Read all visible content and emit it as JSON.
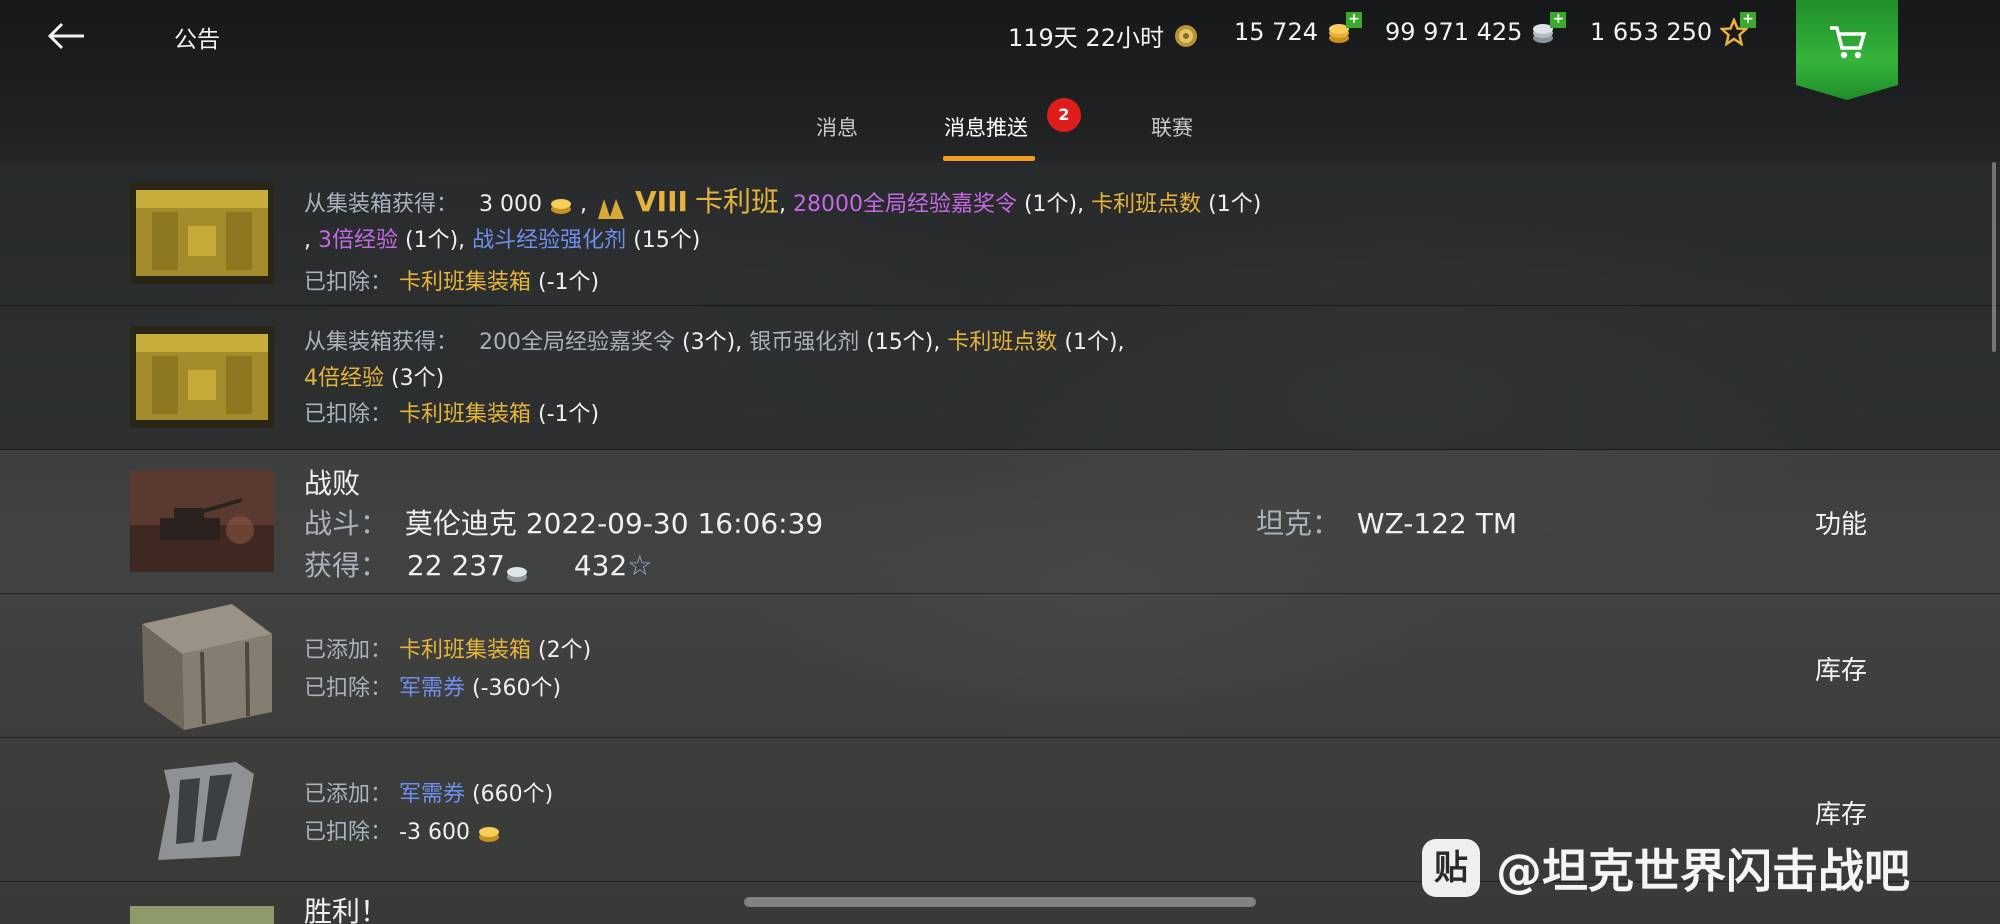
{
  "header": {
    "title": "公告",
    "premium": "119天 22小时",
    "gold": "15 724",
    "silver": "99 971 425",
    "free_xp": "1 653 250"
  },
  "tabs": [
    {
      "label": "消息"
    },
    {
      "label": "消息推送",
      "badge": "2"
    },
    {
      "label": "联赛"
    }
  ],
  "rows": [
    {
      "l1_label": "从集装箱获得：",
      "l1_gold": "3 000",
      "l1_sep": ",",
      "l1_tier": "VIII",
      "l1_tank": "卡利班",
      "l1_c": ",",
      "l1_item1": "28000全局经验嘉奖令",
      "l1_item1_n": "(1个),",
      "l1_item2": "卡利班点数",
      "l1_item2_n": "(1个)",
      "l2_c": ",",
      "l2_item1": "3倍经验",
      "l2_item1_n": "(1个),",
      "l2_item2": "战斗经验强化剂",
      "l2_item2_n": "(15个)",
      "l3_label": "已扣除：",
      "l3_item": "卡利班集装箱",
      "l3_n": "(-1个)"
    },
    {
      "l1_label": "从集装箱获得：",
      "l1_item1": "200全局经验嘉奖令",
      "l1_item1_n": "(3个),",
      "l1_item2": "银币强化剂",
      "l1_item2_n": "(15个),",
      "l1_item3": "卡利班点数",
      "l1_item3_n": "(1个),",
      "l2_item": "4倍经验",
      "l2_n": "(3个)",
      "l3_label": "已扣除：",
      "l3_item": "卡利班集装箱",
      "l3_n": "(-1个)"
    },
    {
      "result": "战败",
      "battle_label": "战斗：",
      "battle_value": "莫伦迪克 2022-09-30 16:06:39",
      "tank_label": "坦克：",
      "tank_value": "WZ-122 TM",
      "earn_label": "获得：",
      "earn_silver": "22 237",
      "earn_xp": "432",
      "action": "功能"
    },
    {
      "l1_label": "已添加：",
      "l1_item": "卡利班集装箱",
      "l1_n": "(2个)",
      "l2_label": "已扣除：",
      "l2_item": "军需券",
      "l2_n": "(-360个)",
      "action": "库存"
    },
    {
      "l1_label": "已添加：",
      "l1_item": "军需券",
      "l1_n": "(660个)",
      "l2_label": "已扣除：",
      "l2_value": "-3 600",
      "action": "库存"
    },
    {
      "result": "胜利！"
    }
  ],
  "watermark": {
    "logo": "贴",
    "text": "@坦克世界闪击战吧"
  },
  "colors": {
    "accent": "#f29c1f",
    "gold_text": "#e6b43c",
    "purple_text": "#c569e5",
    "blue_text": "#6f8ff0",
    "shop_green": "#35b43a",
    "badge_red": "#e01d1d"
  }
}
